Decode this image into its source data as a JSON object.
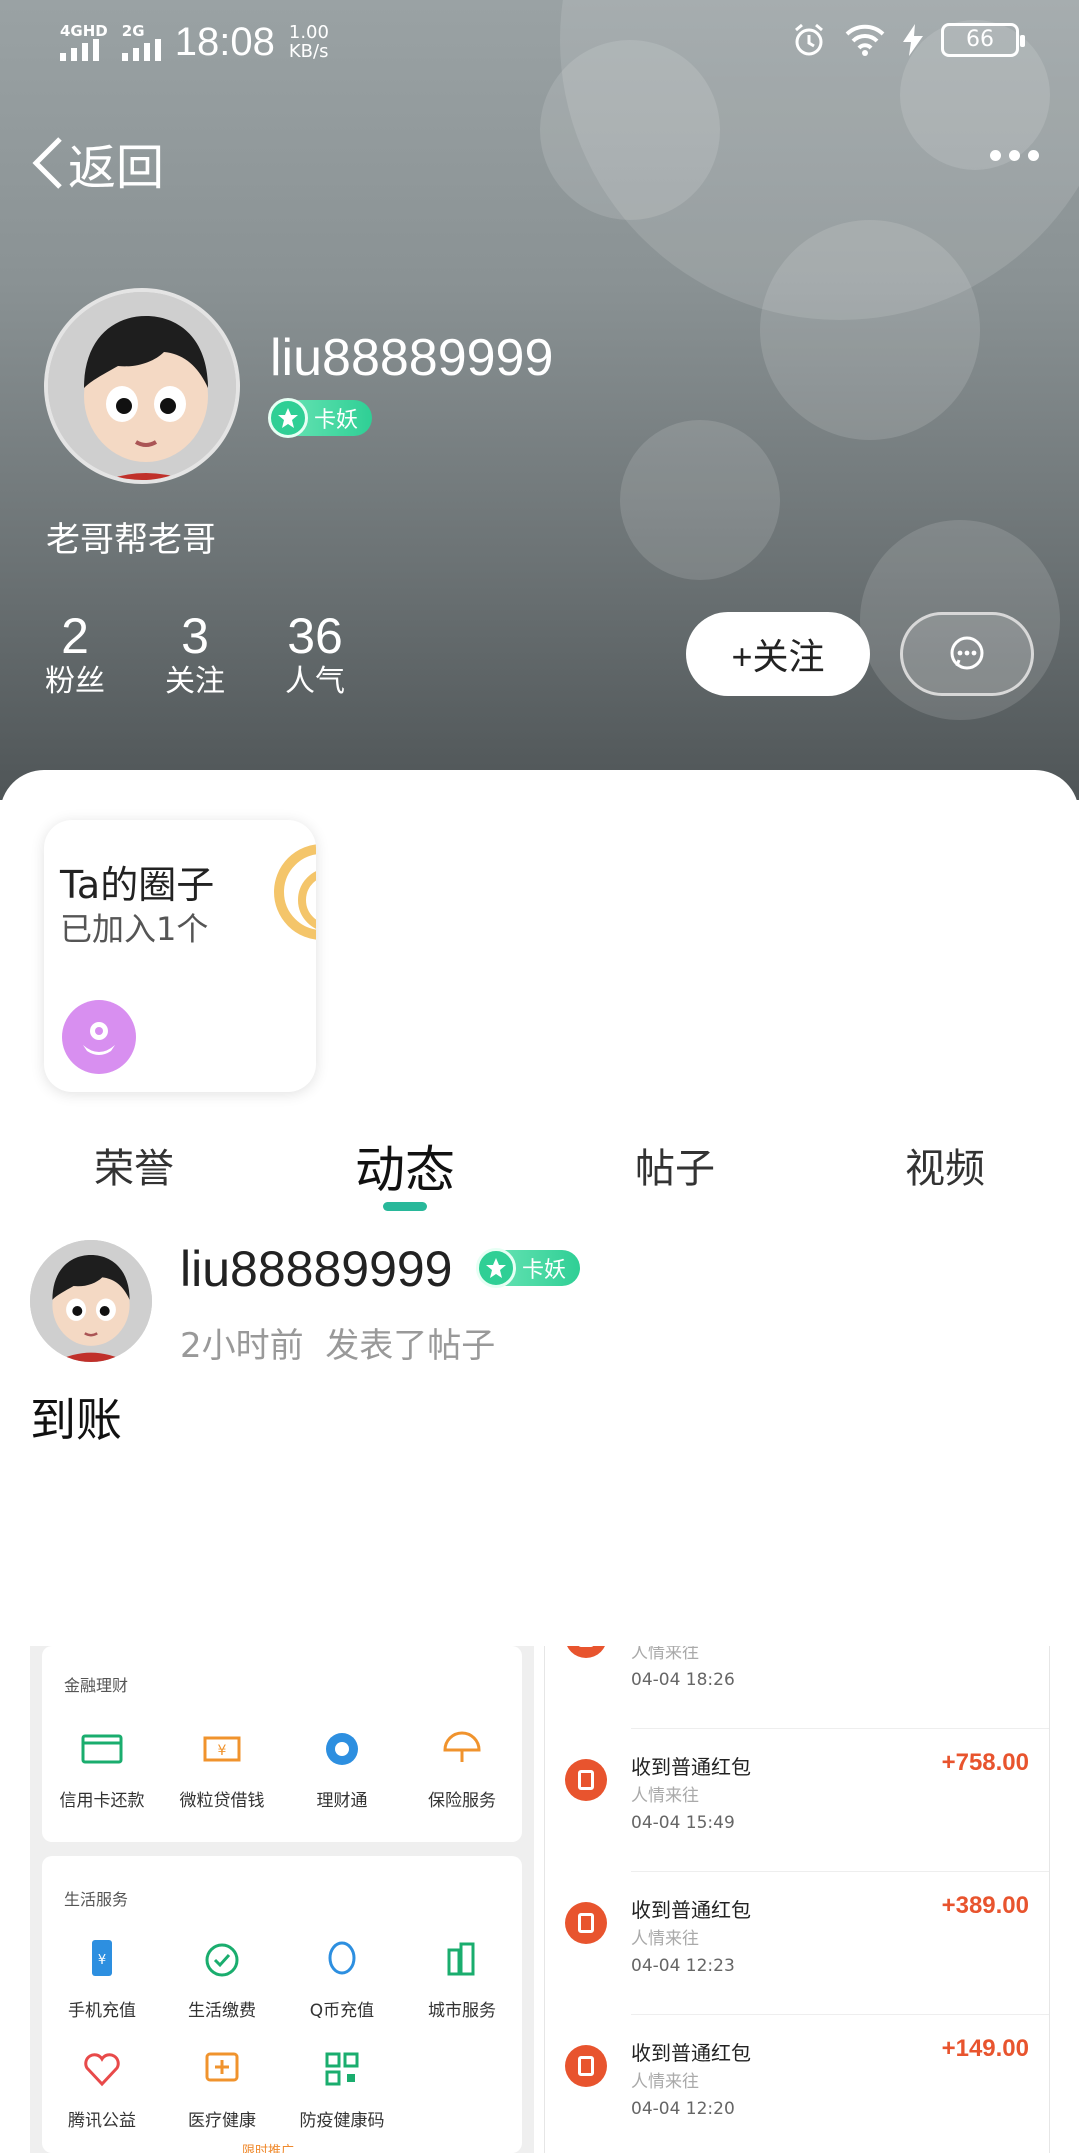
{
  "status_bar": {
    "network_1": "4GHD",
    "network_2": "2G",
    "time": "18:08",
    "speed_value": "1.00",
    "speed_unit": "KB/s",
    "battery": "66"
  },
  "nav": {
    "back_label": "返回"
  },
  "profile": {
    "username": "liu88889999",
    "badge_label": "卡妖",
    "signature": "老哥帮老哥",
    "stats": [
      {
        "value": "2",
        "label": "粉丝"
      },
      {
        "value": "3",
        "label": "关注"
      },
      {
        "value": "36",
        "label": "人气"
      }
    ],
    "follow_label": "+关注"
  },
  "circle_card": {
    "title": "Ta的圈子",
    "subtitle": "已加入1个"
  },
  "tabs": [
    {
      "label": "荣誉",
      "active": false
    },
    {
      "label": "动态",
      "active": true
    },
    {
      "label": "帖子",
      "active": false
    },
    {
      "label": "视频",
      "active": false
    }
  ],
  "post": {
    "username": "liu88889999",
    "badge_label": "卡妖",
    "time_ago": "2小时前",
    "action": "发表了帖子",
    "text": "到账"
  },
  "embedded_left": {
    "finance_header": "金融理财",
    "finance_items": [
      "信用卡还款",
      "微粒贷借钱",
      "理财通",
      "保险服务"
    ],
    "life_header": "生活服务",
    "life_items": [
      "手机充值",
      "生活缴费",
      "Q币充值",
      "城市服务"
    ],
    "life_items_2": [
      "腾讯公益",
      "医疗健康",
      "防疫健康码"
    ],
    "promo": "限时推广"
  },
  "embedded_right": {
    "partial_sub": "人情来往",
    "partial_date": "04-04 18:26",
    "transactions": [
      {
        "title": "收到普通红包",
        "sub": "人情来往",
        "date": "04-04 15:49",
        "amount": "+758.00"
      },
      {
        "title": "收到普通红包",
        "sub": "人情来往",
        "date": "04-04 12:23",
        "amount": "+389.00"
      },
      {
        "title": "收到普通红包",
        "sub": "人情来往",
        "date": "04-04 12:20",
        "amount": "+149.00"
      }
    ]
  },
  "colors": {
    "accent_green": "#28b89a",
    "badge_green": "#2fcf95",
    "red_amount": "#e8542e"
  }
}
